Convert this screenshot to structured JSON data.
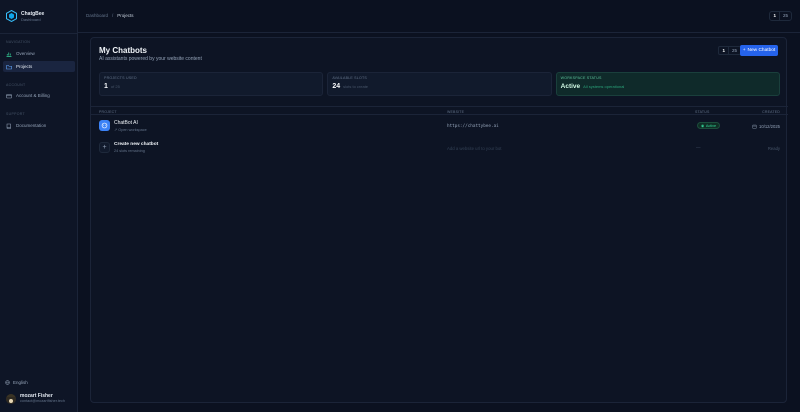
{
  "sidebar": {
    "brand_name": "ChatgBee",
    "brand_sub": "Dashboard",
    "sections": {
      "main": "Navigation",
      "account": "Account",
      "support": "Support"
    },
    "items": [
      {
        "label": "Overview",
        "icon": "chart-icon"
      },
      {
        "label": "Projects",
        "icon": "folder-icon",
        "active": true
      },
      {
        "label": "Account & Billing",
        "icon": "credit-card-icon"
      },
      {
        "label": "Documentation",
        "icon": "book-icon"
      }
    ],
    "language": "English",
    "user": {
      "name": "mozart Fisher",
      "email": "contact@mozartfisher.tech"
    }
  },
  "topbar": {
    "breadcrumb_root": "Dashboard",
    "breadcrumb_sep": "/",
    "breadcrumb_current": "Projects",
    "counter_value": "1",
    "counter_max": "25"
  },
  "main": {
    "title": "My Chatbots",
    "subtitle": "AI assistants powered by your website content",
    "counter_value": "1",
    "counter_max": "25",
    "new_button": "New Chatbot",
    "stats": [
      {
        "label": "Projects used",
        "value": "1",
        "extra": "of 25"
      },
      {
        "label": "Available slots",
        "value": "24",
        "extra": "slots to create"
      },
      {
        "label": "Workspace status",
        "value": "Active",
        "extra": "All systems operational"
      }
    ],
    "table": {
      "headers": {
        "project": "Project",
        "website": "Website",
        "status": "Status",
        "created": "Created"
      },
      "rows": [
        {
          "name": "ChatBot AI",
          "sub": "Open workspace",
          "website": "https://chattybee.ai",
          "status": "Active",
          "created": "10/12/2025"
        },
        {
          "name": "Create new chatbot",
          "sub": "24 slots remaining",
          "website": "Add a website url to your bot",
          "status": "—",
          "created": "Ready"
        }
      ]
    }
  },
  "colors": {
    "accent": "#2563eb",
    "success": "#34d399",
    "background": "#0b1120"
  }
}
